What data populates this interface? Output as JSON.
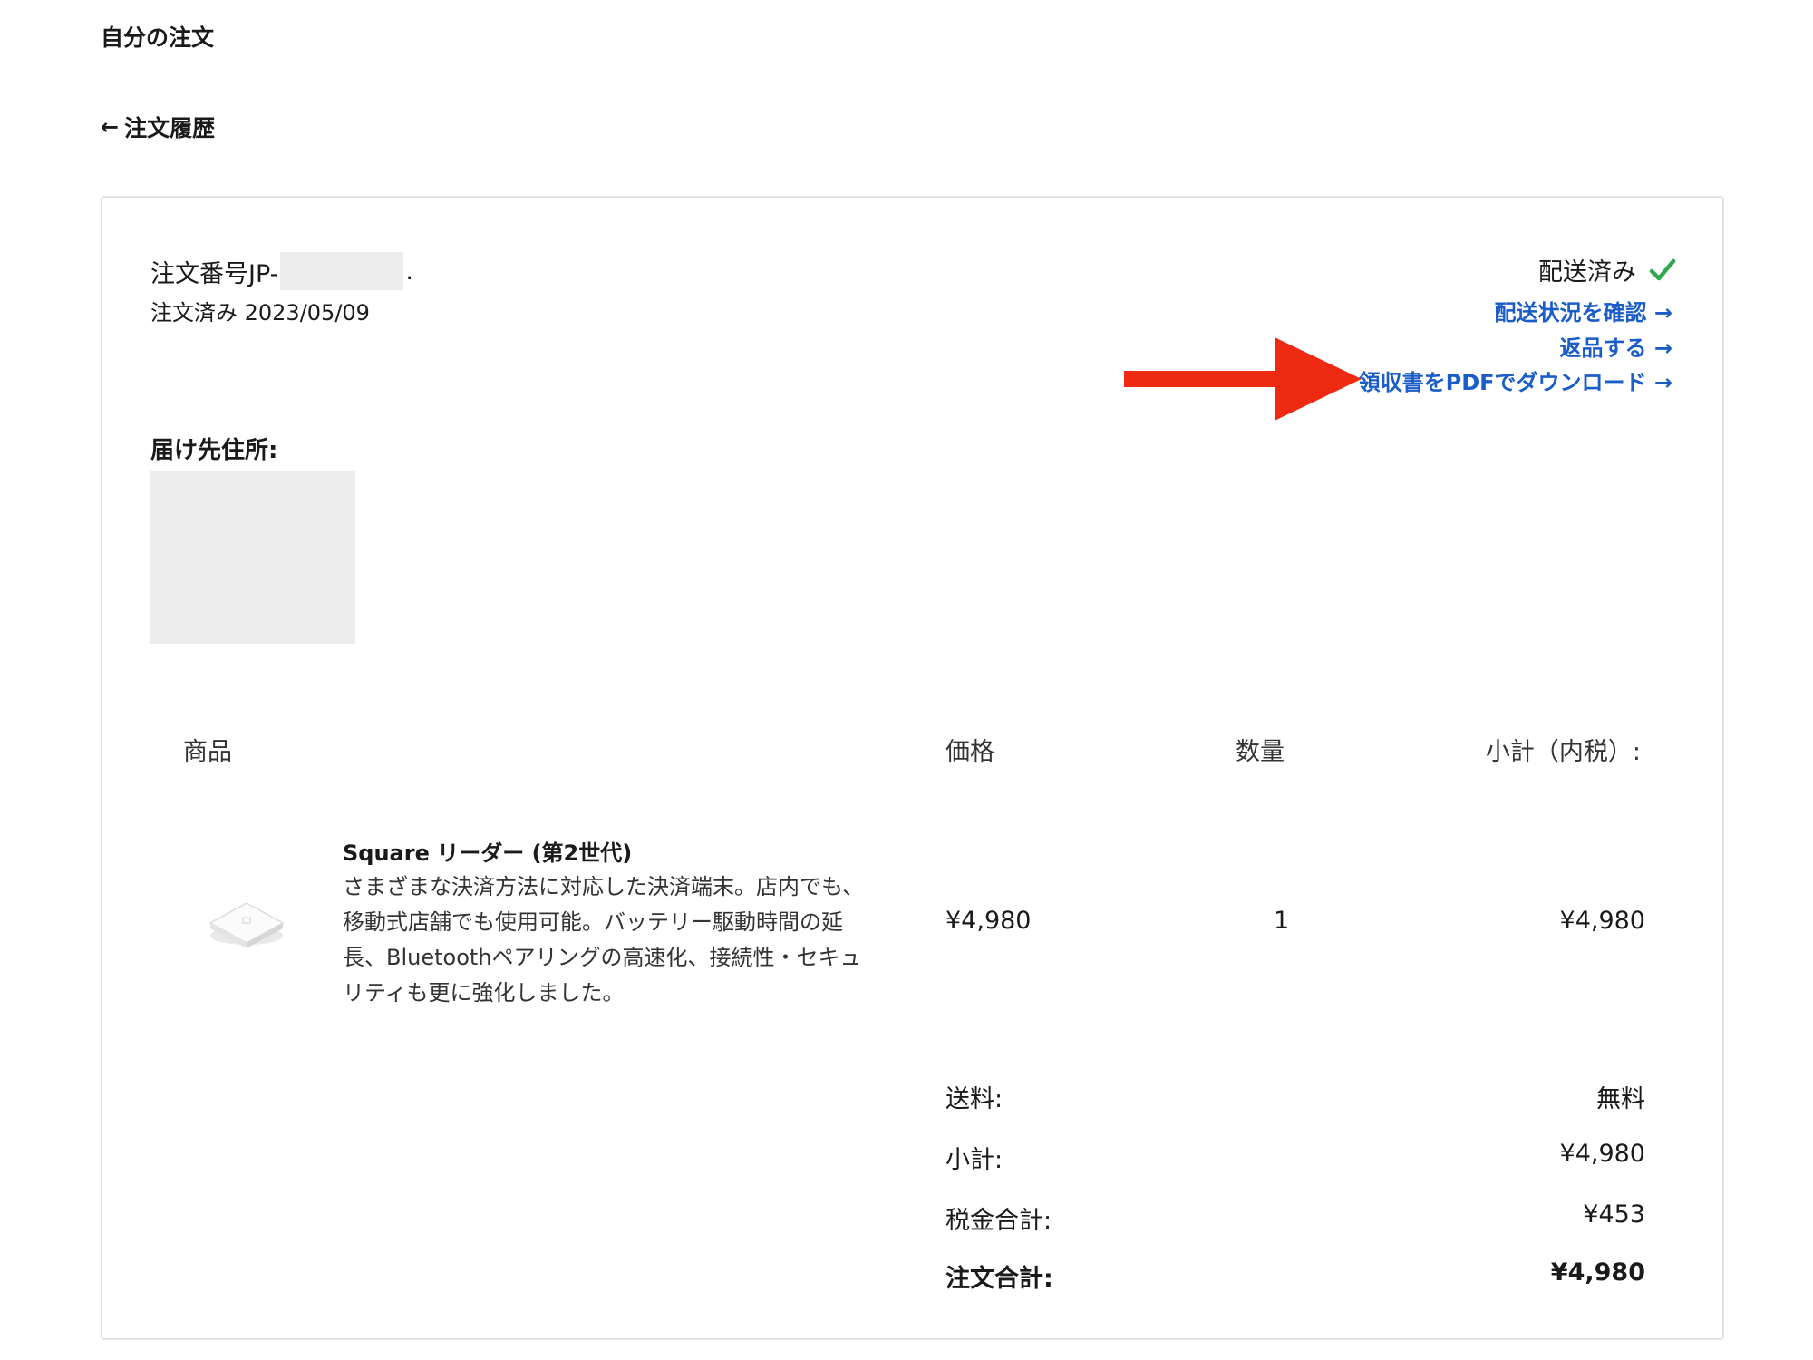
{
  "page": {
    "heading": "自分の注文",
    "back_label": "注文履歴"
  },
  "order": {
    "number_prefix": "注文番号JP-",
    "number_suffix": ".",
    "ordered_label": "注文済み 2023/05/09",
    "status": "配送済み",
    "status_color": "#2fa84f"
  },
  "links": {
    "track": "配送状況を確認 →",
    "return": "返品する →",
    "receipt": "領収書をPDFでダウンロード →",
    "link_color": "#1a5cc8"
  },
  "annotation": {
    "arrow_color": "#ee2a12"
  },
  "shipping": {
    "label": "届け先住所:"
  },
  "table": {
    "headers": {
      "product": "商品",
      "price": "価格",
      "quantity": "数量",
      "subtotal": "小計（内税）:"
    },
    "items": [
      {
        "name": "Square リーダー (第2世代)",
        "description": "さまざまな決済方法に対応した決済端末。店内でも、移動式店舗でも使用可能。バッテリー駆動時間の延長、Bluetoothペアリングの高速化、接続性・セキュリティも更に強化しました。",
        "price": "¥4,980",
        "quantity": "1",
        "subtotal": "¥4,980"
      }
    ]
  },
  "summary": {
    "shipping_label": "送料:",
    "shipping_value": "無料",
    "subtotal_label": "小計:",
    "subtotal_value": "¥4,980",
    "tax_label": "税金合計:",
    "tax_value": "¥453",
    "total_label": "注文合計:",
    "total_value": "¥4,980"
  }
}
